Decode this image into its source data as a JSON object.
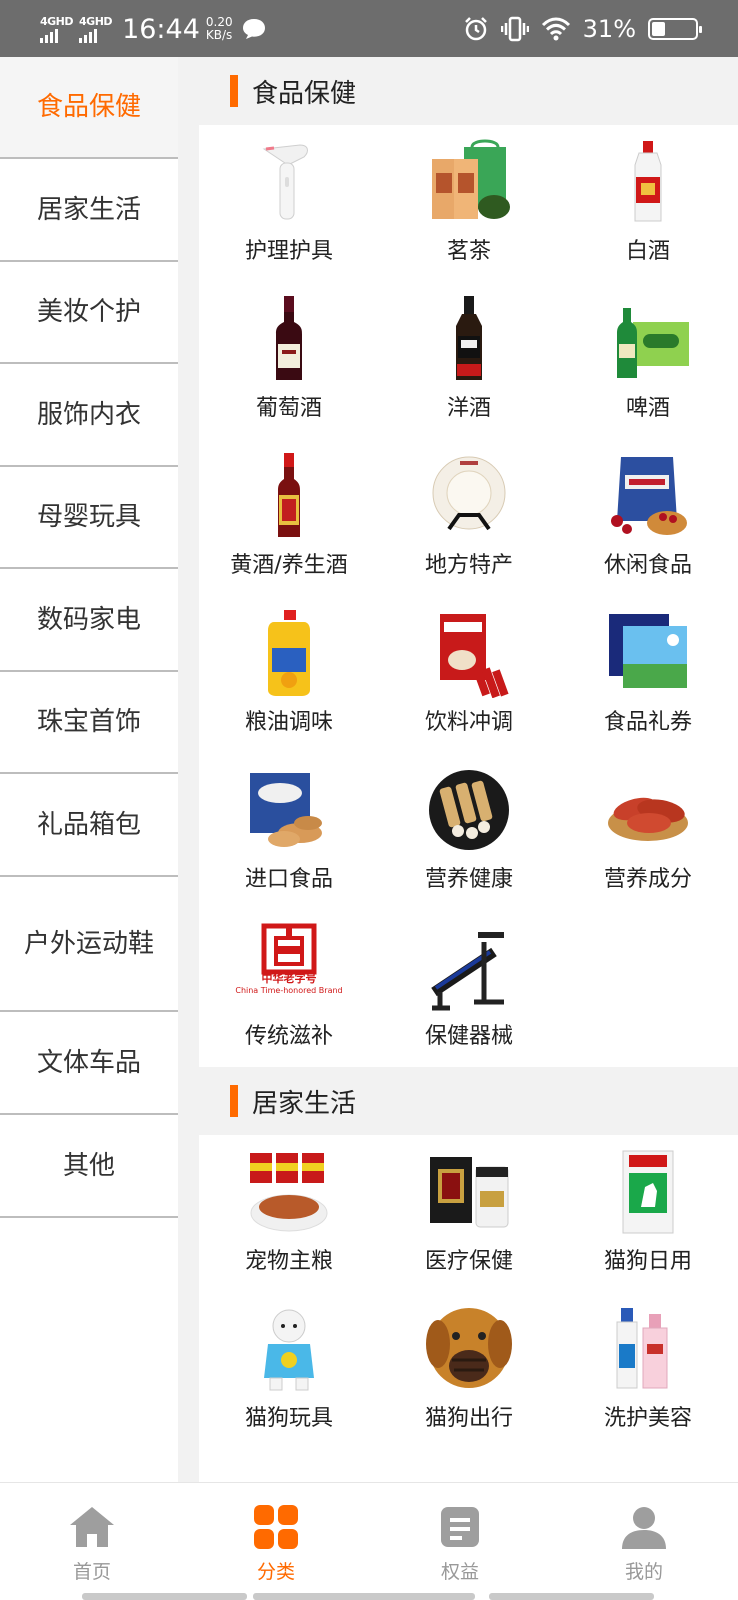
{
  "status_bar": {
    "network_1": "4GHD",
    "network_2": "4GHD",
    "time": "16:44",
    "speed_value": "0.20",
    "speed_unit": "KB/s",
    "battery_text": "31%",
    "battery_level": 0.31
  },
  "sidebar": {
    "items": [
      {
        "label": "食品保健"
      },
      {
        "label": "居家生活"
      },
      {
        "label": "美妆个护"
      },
      {
        "label": "服饰内衣"
      },
      {
        "label": "母婴玩具"
      },
      {
        "label": "数码家电"
      },
      {
        "label": "珠宝首饰"
      },
      {
        "label": "礼品箱包"
      },
      {
        "label": "户外运动鞋"
      },
      {
        "label": "文体车品"
      },
      {
        "label": "其他"
      }
    ]
  },
  "sections": [
    {
      "title": "食品保健",
      "items": [
        {
          "label": "护理护具",
          "icon": "hair-removal-device-image"
        },
        {
          "label": "茗茶",
          "icon": "tea-gift-box-image"
        },
        {
          "label": "白酒",
          "icon": "baijiu-bottle-image"
        },
        {
          "label": "葡萄酒",
          "icon": "wine-bottle-image"
        },
        {
          "label": "洋酒",
          "icon": "whiskey-bottle-image"
        },
        {
          "label": "啤酒",
          "icon": "beer-crate-image"
        },
        {
          "label": "黄酒/养生酒",
          "icon": "yellow-wine-bottle-image"
        },
        {
          "label": "地方特产",
          "icon": "tea-cake-image"
        },
        {
          "label": "休闲食品",
          "icon": "craisins-snack-image"
        },
        {
          "label": "粮油调味",
          "icon": "cooking-oil-image"
        },
        {
          "label": "饮料冲调",
          "icon": "nescafe-coffee-image"
        },
        {
          "label": "食品礼券",
          "icon": "gift-voucher-image"
        },
        {
          "label": "进口食品",
          "icon": "danish-cookies-image"
        },
        {
          "label": "营养健康",
          "icon": "sesame-bars-image"
        },
        {
          "label": "营养成分",
          "icon": "sweet-potato-image"
        },
        {
          "label": "传统滋补",
          "icon": "time-honored-brand-logo-image"
        },
        {
          "label": "保健器械",
          "icon": "sit-up-bench-image"
        }
      ]
    },
    {
      "title": "居家生活",
      "items": [
        {
          "label": "宠物主粮",
          "icon": "pet-food-cans-image"
        },
        {
          "label": "医疗保健",
          "icon": "medicine-box-image"
        },
        {
          "label": "猫狗日用",
          "icon": "dog-food-bag-image"
        },
        {
          "label": "猫狗玩具",
          "icon": "dog-clothes-image"
        },
        {
          "label": "猫狗出行",
          "icon": "dog-muzzle-image"
        },
        {
          "label": "洗护美容",
          "icon": "shampoo-bottles-image"
        }
      ]
    }
  ],
  "brand_logo_text": "中华老字号",
  "brand_logo_subtext": "China Time-honored Brand",
  "bottom_nav": [
    {
      "label": "首页",
      "icon": "home-icon"
    },
    {
      "label": "分类",
      "icon": "category-icon"
    },
    {
      "label": "权益",
      "icon": "benefits-icon"
    },
    {
      "label": "我的",
      "icon": "profile-icon"
    }
  ],
  "colors": {
    "accent": "#ff6a00",
    "status_bar": "#6d6d6d",
    "nav_inactive": "#999999"
  }
}
